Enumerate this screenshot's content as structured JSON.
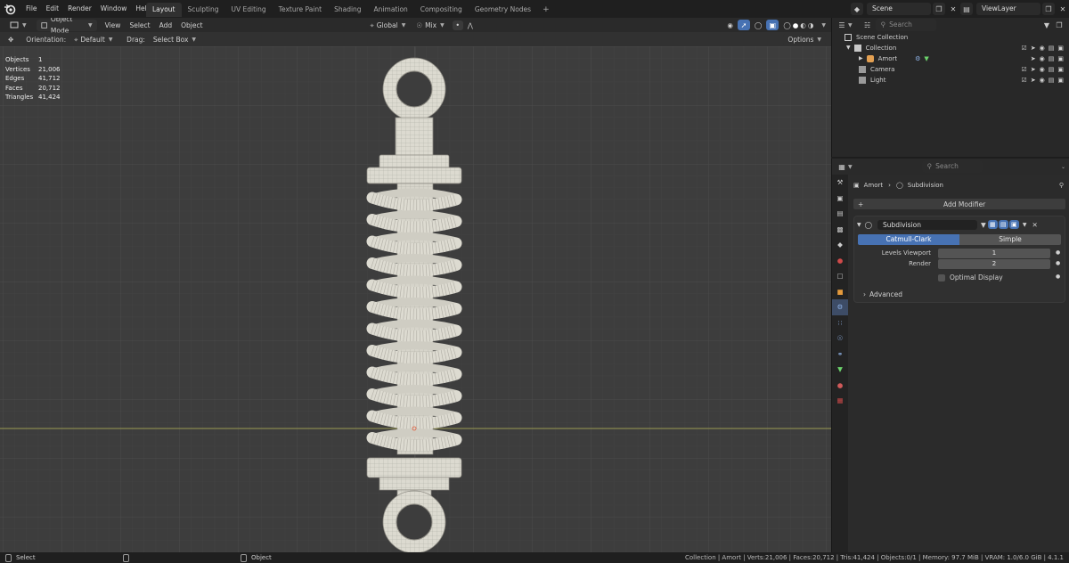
{
  "menu": [
    "File",
    "Edit",
    "Render",
    "Window",
    "Help"
  ],
  "workspaces": [
    "Layout",
    "Sculpting",
    "UV Editing",
    "Texture Paint",
    "Shading",
    "Animation",
    "Compositing",
    "Geometry Nodes"
  ],
  "scene": "Scene",
  "viewlayer": "ViewLayer",
  "viewport": {
    "mode": "Object Mode",
    "menus": [
      "View",
      "Select",
      "Add",
      "Object"
    ],
    "transform": "Global",
    "pivot": "Mix",
    "orientation_label": "Orientation:",
    "orientation_value": "Default",
    "drag_label": "Drag:",
    "drag_value": "Select Box",
    "options": "Options"
  },
  "stats": [
    {
      "k": "Objects",
      "v": "1"
    },
    {
      "k": "Vertices",
      "v": "21,006"
    },
    {
      "k": "Edges",
      "v": "41,712"
    },
    {
      "k": "Faces",
      "v": "20,712"
    },
    {
      "k": "Triangles",
      "v": "41,424"
    }
  ],
  "outliner": {
    "search_placeholder": "Search",
    "root": "Scene Collection",
    "items": [
      "Collection",
      "Amort",
      "Camera",
      "Light"
    ]
  },
  "properties": {
    "search_placeholder": "Search",
    "breadcrumb_object": "Amort",
    "breadcrumb_modifier": "Subdivision",
    "add_modifier": "Add Modifier",
    "modifier_name": "Subdivision",
    "modes": [
      "Catmull-Clark",
      "Simple"
    ],
    "levels_viewport_label": "Levels Viewport",
    "levels_viewport": "1",
    "render_label": "Render",
    "render": "2",
    "optimal_display": "Optimal Display",
    "advanced": "Advanced"
  },
  "statusbar": {
    "left": "Select",
    "mid": "Object",
    "right": "Collection | Amort | Verts:21,006 | Faces:20,712 | Tris:41,424 | Objects:0/1 | Memory: 97.7 MiB | VRAM: 1.0/6.0 GiB | 4.1.1"
  },
  "colors": {
    "accent": "#4772b3",
    "x_axis": "#c0c060",
    "viewport_bg": "#3d3d3d",
    "mesh": "#dcdad0"
  }
}
